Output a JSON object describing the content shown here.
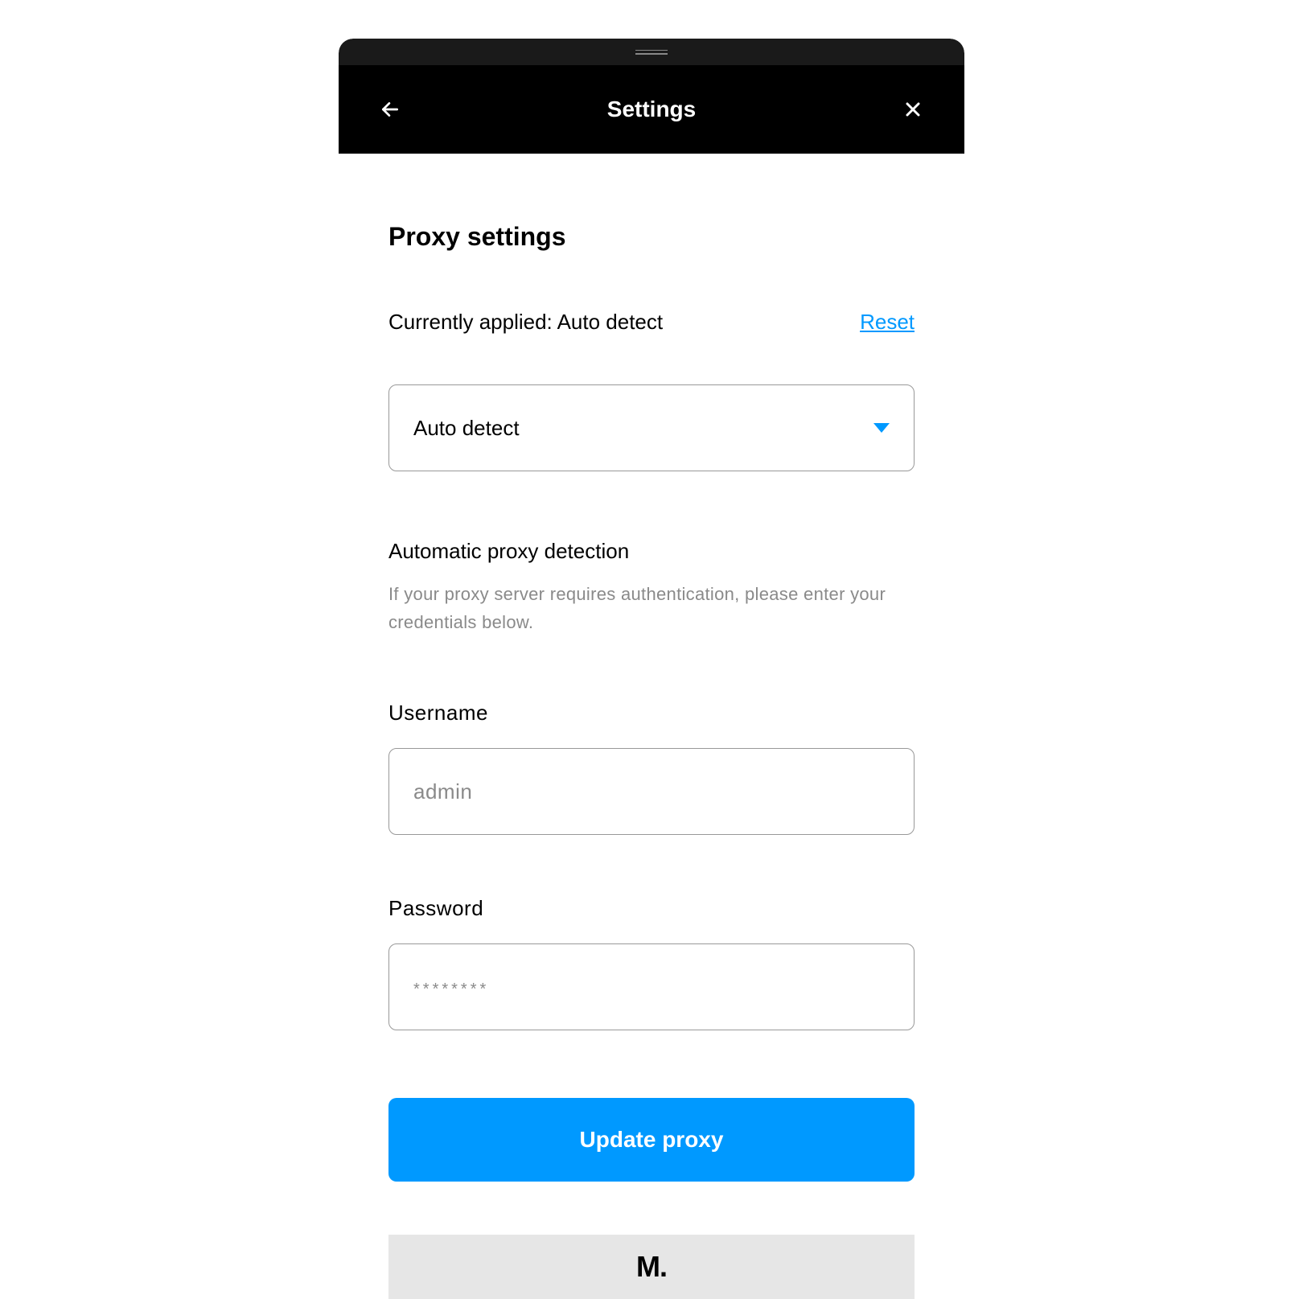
{
  "header": {
    "title": "Settings"
  },
  "section": {
    "title": "Proxy settings",
    "applied_prefix": "Currently applied: ",
    "applied_value": "Auto detect",
    "reset_label": "Reset"
  },
  "select": {
    "value": "Auto detect"
  },
  "auto": {
    "title": "Automatic proxy detection",
    "help": "If your proxy server requires authentication, please enter your credentials below."
  },
  "form": {
    "username_label": "Username",
    "username_placeholder": "admin",
    "username_value": "",
    "password_label": "Password",
    "password_placeholder": "********",
    "password_value": "",
    "submit_label": "Update proxy"
  },
  "footer": {
    "logo": "M."
  }
}
